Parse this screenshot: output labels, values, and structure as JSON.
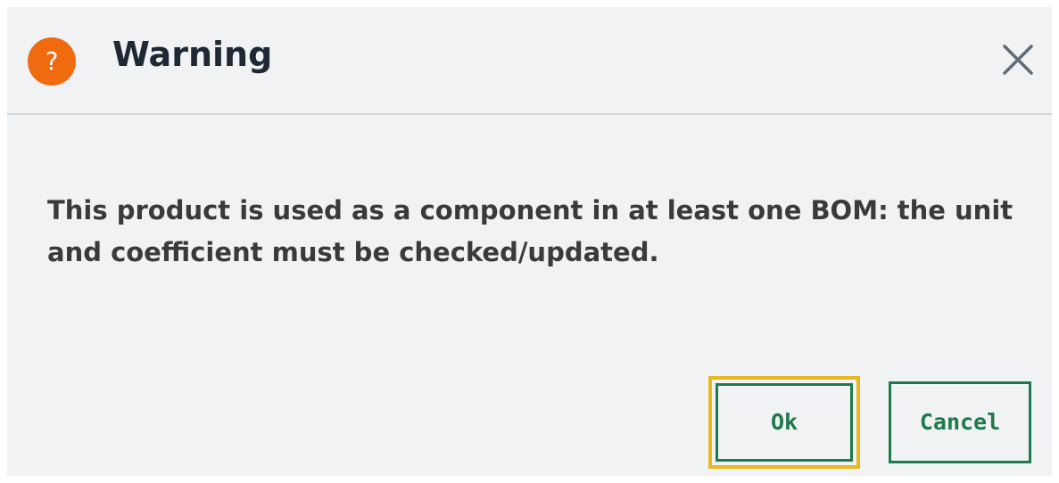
{
  "dialog": {
    "icon": "question-mark-icon",
    "icon_glyph": "?",
    "title": "Warning",
    "close_icon": "close-icon",
    "message": "This product is used as a component in at least one BOM: the unit and coefficient must be checked/updated.",
    "buttons": {
      "ok_label": "Ok",
      "cancel_label": "Cancel"
    }
  },
  "colors": {
    "icon_bg": "#f06a10",
    "button_border": "#1e7a4a",
    "focus_ring": "#e8b81e",
    "dialog_bg": "#f0f2f4"
  }
}
